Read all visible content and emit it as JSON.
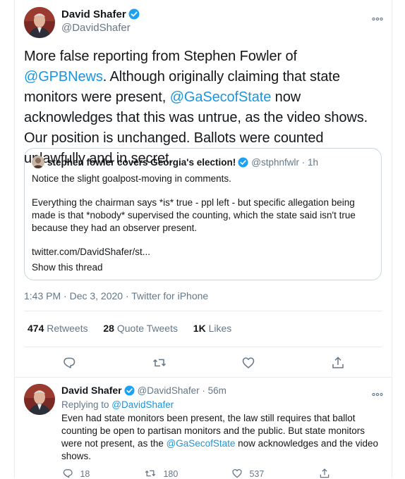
{
  "tweet": {
    "author_name": "David Shafer",
    "author_handle": "@DavidShafer",
    "text_part1": "More false reporting from Stephen Fowler of ",
    "mention1": "@GPBNews",
    "text_part2": ". Although originally claiming that state monitors were present, ",
    "mention2": "@GaSecofState",
    "text_part3": " now acknowledges that this was untrue, as the video shows. Our position is unchanged. Ballots were counted unlawfully and in secret.",
    "meta": "1:43 PM · Dec 3, 2020 · Twitter for iPhone",
    "stats": {
      "retweets_count": "474",
      "retweets_label": "Retweets",
      "quotes_count": "28",
      "quotes_label": "Quote Tweets",
      "likes_count": "1K",
      "likes_label": "Likes"
    }
  },
  "quoted": {
    "author_name": "stephen fowler covers Georgia's election!",
    "author_handle": "@stphnfwlr",
    "time": "· 1h",
    "line1": "Notice the slight goalpost-moving in comments.",
    "para2": "Everything the chairman says *is* true - ppl left - but specific allegation being made is that *nobody* supervised the counting, which the state said isn't true because they had an observer present.",
    "link": "twitter.com/DavidShafer/st...",
    "show_thread": "Show this thread"
  },
  "reply": {
    "author_name": "David Shafer",
    "author_handle": "@DavidShafer",
    "time": "· 56m",
    "replying_prefix": "Replying to ",
    "replying_to": "@DavidShafer",
    "text_part1": "Even had state monitors been present, the law still requires that ballot counting be open to partisan monitors and the public. But state monitors were not present, as the ",
    "mention": "@GaSecofState",
    "text_part2": " now acknowledges and the video shows.",
    "actions": {
      "replies": "18",
      "retweets": "180",
      "likes": "537"
    }
  },
  "colors": {
    "link": "#1b95e0",
    "secondary": "#657786",
    "border": "#e6ecf0",
    "verified": "#1da1f2"
  },
  "icons": [
    "verified-badge-icon",
    "more-icon",
    "reply-icon",
    "retweet-icon",
    "like-icon",
    "share-icon",
    "avatar"
  ]
}
